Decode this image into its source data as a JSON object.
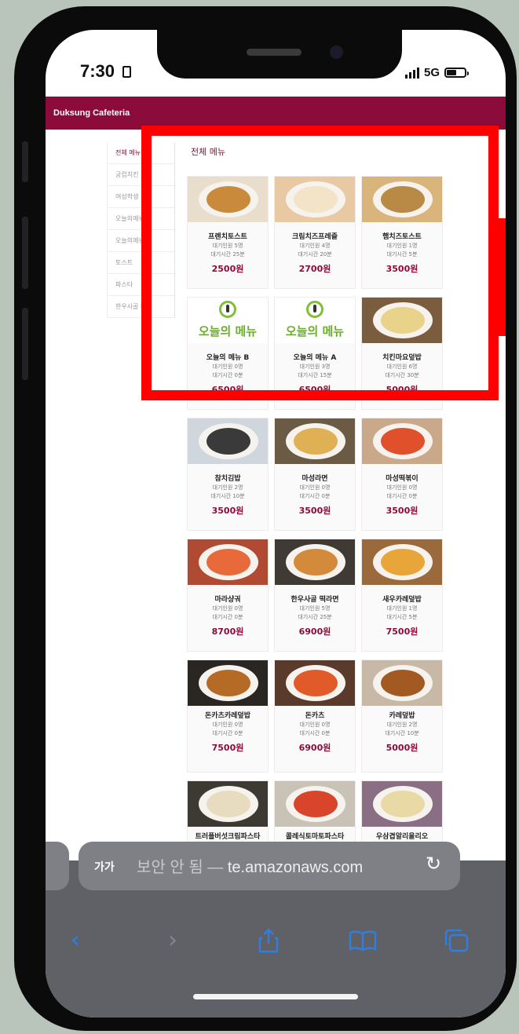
{
  "status_bar": {
    "time": "7:30",
    "network": "5G"
  },
  "header": {
    "title": "Duksung Cafeteria"
  },
  "sidebar": {
    "items": [
      {
        "label": "전체 메뉴",
        "active": true
      },
      {
        "label": "궁컵치킨"
      },
      {
        "label": "여성학생"
      },
      {
        "label": "오늘의메뉴"
      },
      {
        "label": "오늘의메뉴"
      },
      {
        "label": "토스트"
      },
      {
        "label": "파스타"
      },
      {
        "label": "한우사골 메뉴"
      }
    ]
  },
  "main": {
    "section_title": "전체 메뉴",
    "wait_label": "대기인원",
    "time_label": "대기시간",
    "menus": [
      {
        "name": "프렌치토스트",
        "wait": "5명",
        "time": "25분",
        "price": "2500원",
        "thumb": "photo-toast"
      },
      {
        "name": "크림치즈프레즐",
        "wait": "4명",
        "time": "20분",
        "price": "2700원",
        "thumb": "photo-pretzel"
      },
      {
        "name": "햄치즈토스트",
        "wait": "1명",
        "time": "5분",
        "price": "3500원",
        "thumb": "photo-sandwich"
      },
      {
        "name": "오늘의 메뉴 B",
        "wait": "0명",
        "time": "0분",
        "price": "6500원",
        "thumb": "logo",
        "logo_text": "오늘의 메뉴"
      },
      {
        "name": "오늘의 메뉴 A",
        "wait": "3명",
        "time": "15분",
        "price": "6500원",
        "thumb": "logo",
        "logo_text": "오늘의 메뉴"
      },
      {
        "name": "치킨마요덮밥",
        "wait": "6명",
        "time": "30분",
        "price": "5000원",
        "thumb": "photo-mayo"
      },
      {
        "name": "참치김밥",
        "wait": "2명",
        "time": "10분",
        "price": "3500원",
        "thumb": "photo-gimbap"
      },
      {
        "name": "마성라면",
        "wait": "0명",
        "time": "0분",
        "price": "3500원",
        "thumb": "photo-ramen"
      },
      {
        "name": "마성떡볶이",
        "wait": "0명",
        "time": "0분",
        "price": "3500원",
        "thumb": "photo-tteok"
      },
      {
        "name": "마라샹궈",
        "wait": "0명",
        "time": "0분",
        "price": "8700원",
        "thumb": "photo-mala"
      },
      {
        "name": "한우사골 떡라면",
        "wait": "5명",
        "time": "25분",
        "price": "6900원",
        "thumb": "photo-soup"
      },
      {
        "name": "새우카레덮밥",
        "wait": "1명",
        "time": "5분",
        "price": "7500원",
        "thumb": "photo-shrimp"
      },
      {
        "name": "돈카츠카레덮밥",
        "wait": "0명",
        "time": "0분",
        "price": "7500원",
        "thumb": "photo-katsucurry"
      },
      {
        "name": "돈카츠",
        "wait": "0명",
        "time": "0분",
        "price": "6900원",
        "thumb": "photo-katsu"
      },
      {
        "name": "카레덮밥",
        "wait": "2명",
        "time": "10분",
        "price": "5000원",
        "thumb": "photo-curry"
      },
      {
        "name": "트러플버섯크림파스타",
        "wait": "",
        "time": "",
        "price": "",
        "thumb": "photo-pasta"
      },
      {
        "name": "콜레식토마토파스타",
        "wait": "",
        "time": "",
        "price": "",
        "thumb": "photo-tomato"
      },
      {
        "name": "우삼겹알리올리오",
        "wait": "",
        "time": "",
        "price": "",
        "thumb": "photo-aglio"
      }
    ]
  },
  "browser": {
    "text_size_label": "가가",
    "security_warning": "보안 안 됨 —",
    "url": "te.amazonaws.com"
  },
  "colors": {
    "brand": "#8b0c3a",
    "highlight": "#ff0000",
    "ios_blue": "#2f7fe0"
  }
}
